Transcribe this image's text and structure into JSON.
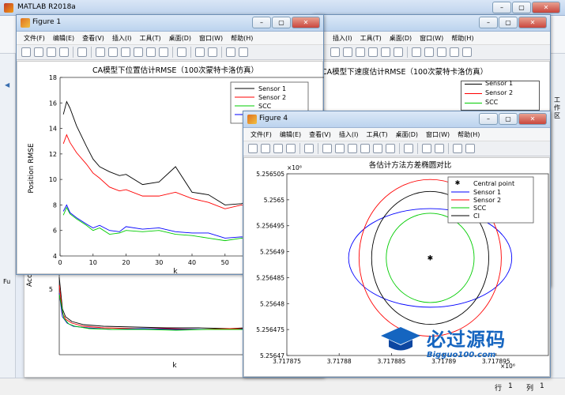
{
  "matlab": {
    "title": "MATLAB R2018a",
    "status_row_label": "行",
    "status_row": "1",
    "status_col_label": "列",
    "status_col": "1",
    "left_frag": "Fu",
    "right_tab": "工作区"
  },
  "menu": [
    "文件(F)",
    "编辑(E)",
    "查看(V)",
    "插入(I)",
    "工具(T)",
    "桌面(D)",
    "窗口(W)",
    "帮助(H)"
  ],
  "figure1": {
    "title": "Figure 1",
    "plot_title": "CA模型下位置估计RMSE（100次蒙特卡洛仿真）",
    "ylabel": "Position RMSE",
    "xlabel": "k",
    "legend": [
      "Sensor 1",
      "Sensor 2",
      "SCC",
      "CI"
    ]
  },
  "figure2": {
    "plot_title": "CA模型下速度估计RMSE（100次蒙特卡洛仿真）",
    "legend": [
      "Sensor 1",
      "Sensor 2",
      "SCC"
    ]
  },
  "figure_behind": {
    "ylabel_frag": "Acc",
    "xlabel": "k"
  },
  "figure4": {
    "title": "Figure 4",
    "plot_title": "各估计方法方差椭圆对比",
    "legend": [
      "Central point",
      "Sensor 1",
      "Sensor 2",
      "SCC",
      "CI"
    ],
    "y_exp": "×10⁶",
    "x_exp": "×10⁶"
  },
  "watermark": {
    "brand": "必过源码",
    "url": "Bigguo100.com"
  },
  "colors": {
    "sensor1": "#000000",
    "sensor2": "#ff0000",
    "scc": "#00cc00",
    "ci": "#0000ff"
  },
  "chart_data": [
    {
      "type": "line",
      "title": "CA模型下位置估计RMSE（100次蒙特卡洛仿真）",
      "xlabel": "k",
      "ylabel": "Position RMSE",
      "xlim": [
        0,
        80
      ],
      "ylim": [
        4,
        18
      ],
      "x_ticks": [
        "0",
        "10",
        "20",
        "30",
        "40",
        "50",
        "60",
        "70",
        "8"
      ],
      "y_ticks": [
        "4",
        "6",
        "8",
        "10",
        "12",
        "14",
        "16",
        "18"
      ],
      "x": [
        1,
        2,
        3,
        5,
        8,
        10,
        12,
        15,
        18,
        20,
        25,
        30,
        35,
        40,
        45,
        50,
        55,
        60,
        65,
        70,
        75,
        80
      ],
      "series": [
        {
          "name": "Sensor 1",
          "values": [
            15.1,
            16.1,
            15.6,
            14.2,
            12.6,
            11.6,
            11.0,
            10.6,
            10.3,
            10.4,
            9.6,
            9.8,
            11.0,
            9.0,
            8.8,
            8.0,
            8.1,
            8.6,
            8.4,
            7.8,
            8.2,
            7.6
          ]
        },
        {
          "name": "Sensor 2",
          "values": [
            12.8,
            13.5,
            12.9,
            12.1,
            11.2,
            10.5,
            10.1,
            9.4,
            9.1,
            9.2,
            8.7,
            8.7,
            9.0,
            8.5,
            8.2,
            7.7,
            8.0,
            7.7,
            7.9,
            7.6,
            8.2,
            7.3
          ]
        },
        {
          "name": "SCC",
          "values": [
            7.2,
            7.8,
            7.3,
            6.9,
            6.4,
            6.0,
            6.2,
            5.7,
            5.8,
            6.0,
            5.9,
            6.0,
            5.7,
            5.6,
            5.4,
            5.2,
            5.4,
            5.1,
            5.3,
            5.0,
            5.3,
            4.9
          ]
        },
        {
          "name": "CI",
          "values": [
            7.5,
            8.0,
            7.4,
            7.0,
            6.5,
            6.2,
            6.4,
            6.0,
            5.9,
            6.3,
            6.1,
            6.2,
            5.9,
            5.8,
            5.8,
            5.4,
            5.5,
            5.3,
            5.6,
            5.2,
            5.5,
            5.0
          ]
        }
      ]
    },
    {
      "type": "line",
      "title": "各估计方法方差椭圆对比",
      "xlim": [
        3717.875,
        3717.9
      ],
      "ylim": [
        5256.47,
        5256.505
      ],
      "x_ticks": [
        "3.717875",
        "3.71788",
        "3.717885",
        "3.71789",
        "3.717895"
      ],
      "y_ticks": [
        "5.25647",
        "5.256475",
        "5.25648",
        "5.256485",
        "5.25649",
        "5.256495",
        "5.2565",
        "5.256505"
      ],
      "central_point": [
        3717.8887,
        5256.4888
      ],
      "ellipses": [
        {
          "name": "Sensor 1",
          "rx": 0.0078,
          "ry": 0.0095
        },
        {
          "name": "Sensor 2",
          "rx": 0.0068,
          "ry": 0.0151
        },
        {
          "name": "SCC",
          "rx": 0.0042,
          "ry": 0.0086
        },
        {
          "name": "CI",
          "rx": 0.0056,
          "ry": 0.0128
        }
      ]
    }
  ]
}
